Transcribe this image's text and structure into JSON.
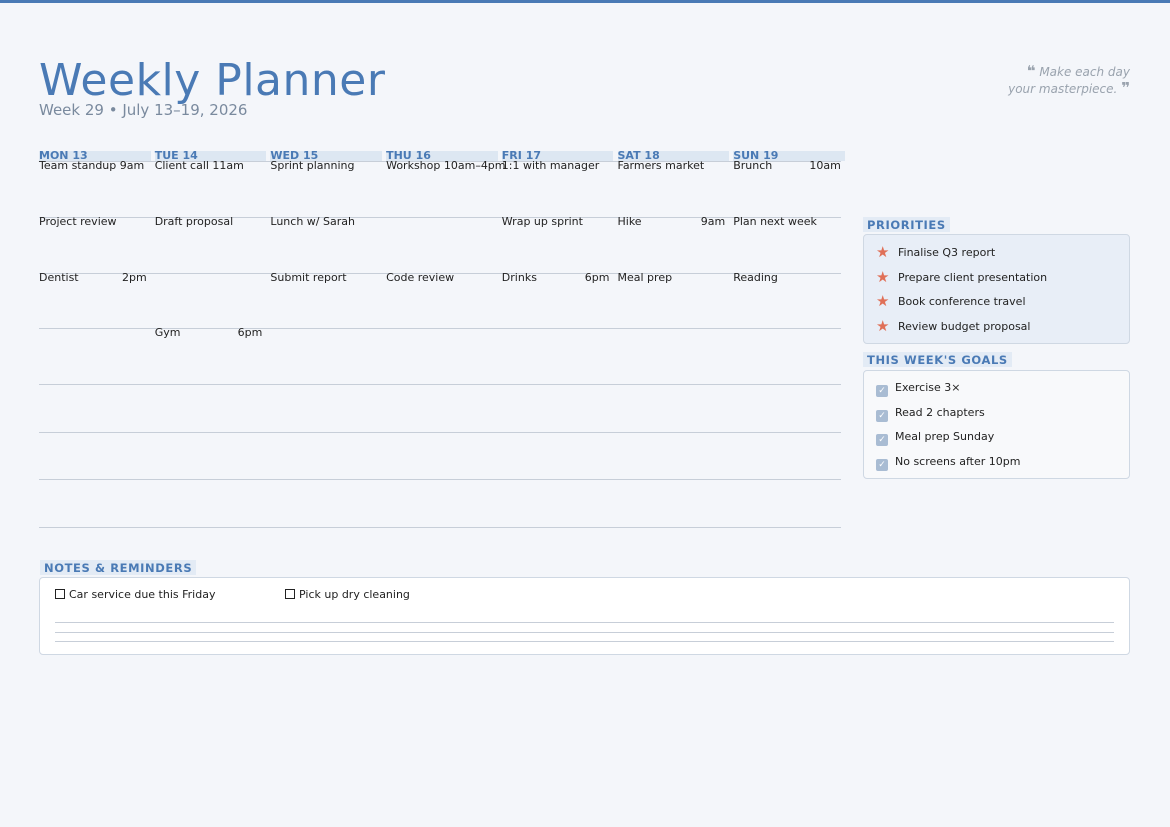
{
  "header": {
    "title": "Weekly Planner",
    "subtitle": "Week 29 • July 13–19, 2026",
    "quote_line1": "Make each day",
    "quote_line2": "your masterpiece."
  },
  "days": [
    {
      "label": "MON 13",
      "events": [
        {
          "text": "Team standup 9am",
          "time": ""
        },
        {
          "text": "Project review",
          "time": ""
        },
        {
          "text": "Dentist",
          "time": "2pm"
        }
      ]
    },
    {
      "label": "TUE 14",
      "events": [
        {
          "text": "Client call 11am",
          "time": ""
        },
        {
          "text": "Draft proposal",
          "time": ""
        },
        {
          "text": "",
          "time": ""
        },
        {
          "text": "Gym",
          "time": "6pm"
        }
      ]
    },
    {
      "label": "WED 15",
      "events": [
        {
          "text": "Sprint planning",
          "time": ""
        },
        {
          "text": "Lunch w/ Sarah",
          "time": ""
        },
        {
          "text": "Submit report",
          "time": ""
        }
      ]
    },
    {
      "label": "THU 16",
      "events": [
        {
          "text": "Workshop 10am–4pm",
          "time": ""
        },
        {
          "text": "",
          "time": ""
        },
        {
          "text": "Code review",
          "time": ""
        }
      ]
    },
    {
      "label": "FRI 17",
      "events": [
        {
          "text": "1:1 with manager",
          "time": ""
        },
        {
          "text": "Wrap up sprint",
          "time": ""
        },
        {
          "text": "Drinks",
          "time": "6pm"
        }
      ]
    },
    {
      "label": "SAT 18",
      "events": [
        {
          "text": "Farmers market",
          "time": ""
        },
        {
          "text": "Hike",
          "time": "9am"
        },
        {
          "text": "Meal prep",
          "time": ""
        }
      ]
    },
    {
      "label": "SUN 19",
      "events": [
        {
          "text": "Brunch",
          "time": "10am"
        },
        {
          "text": "Plan next week",
          "time": ""
        },
        {
          "text": "Reading",
          "time": ""
        }
      ]
    }
  ],
  "priorities": {
    "label": "PRIORITIES",
    "items": [
      "Finalise Q3 report",
      "Prepare client presentation",
      "Book conference travel",
      "Review budget proposal"
    ]
  },
  "goals": {
    "label": "THIS WEEK'S GOALS",
    "items": [
      "Exercise 3×",
      "Read 2 chapters",
      "Meal prep Sunday",
      "No screens after 10pm"
    ]
  },
  "notes": {
    "label": "NOTES & REMINDERS",
    "items": [
      "Car service due this Friday",
      "Pick up dry cleaning"
    ]
  },
  "colors": {
    "accent": "#4a7ab5",
    "star": "#e07058",
    "check": "#a9bcd3",
    "background": "#f4f6fa"
  }
}
